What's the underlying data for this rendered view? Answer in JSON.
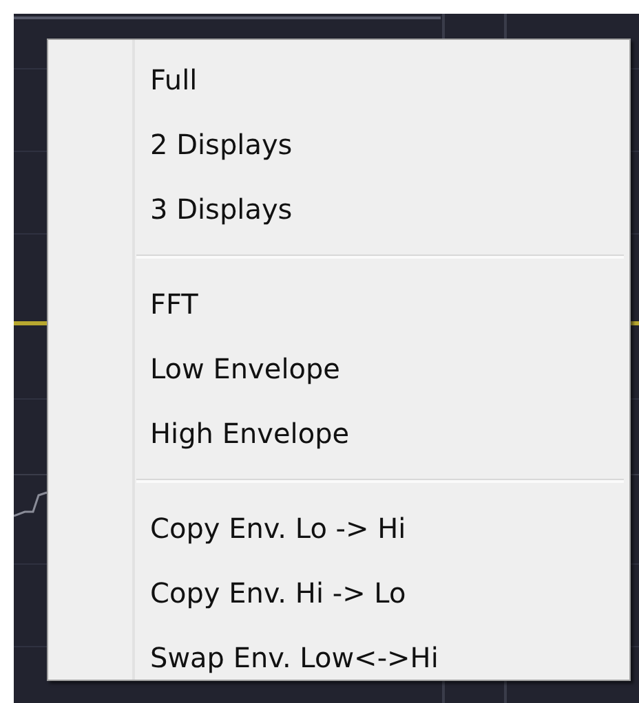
{
  "context_menu": {
    "groups": [
      {
        "items": [
          {
            "label": "Full"
          },
          {
            "label": "2 Displays"
          },
          {
            "label": "3 Displays"
          }
        ]
      },
      {
        "items": [
          {
            "label": "FFT"
          },
          {
            "label": "Low Envelope"
          },
          {
            "label": "High Envelope"
          }
        ]
      },
      {
        "items": [
          {
            "label": "Copy Env. Lo -> Hi"
          },
          {
            "label": "Copy Env. Hi -> Lo"
          },
          {
            "label": "Swap Env. Low<->Hi"
          }
        ]
      }
    ]
  }
}
